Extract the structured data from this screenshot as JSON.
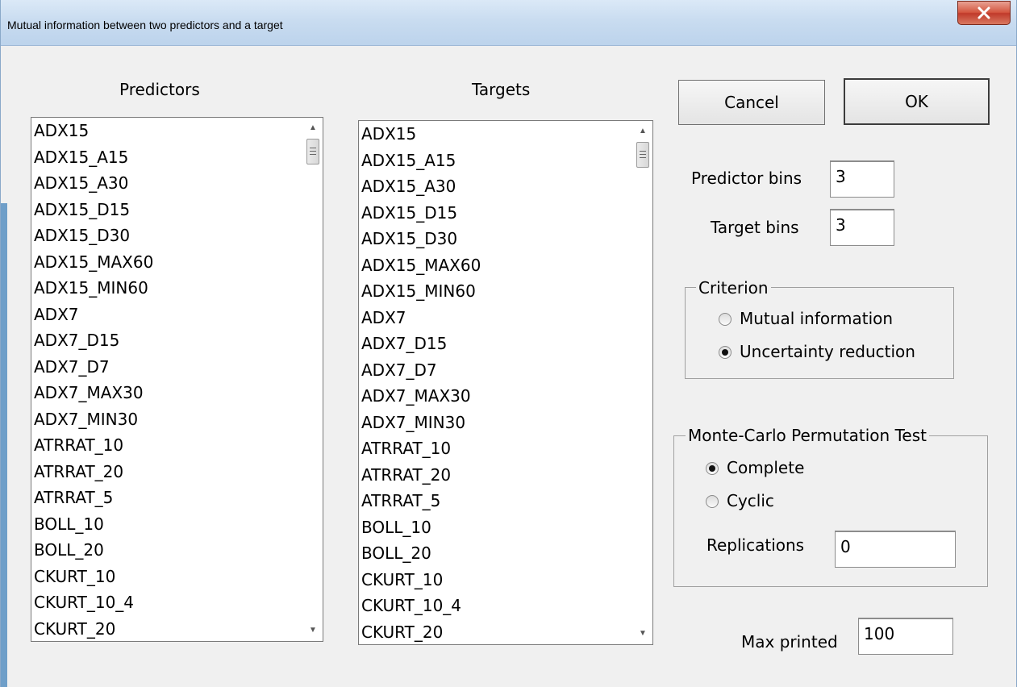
{
  "window": {
    "title": "Mutual information between two predictors and a target",
    "close_label": "X"
  },
  "predictors": {
    "label": "Predictors",
    "items": [
      "ADX15",
      "ADX15_A15",
      "ADX15_A30",
      "ADX15_D15",
      "ADX15_D30",
      "ADX15_MAX60",
      "ADX15_MIN60",
      "ADX7",
      "ADX7_D15",
      "ADX7_D7",
      "ADX7_MAX30",
      "ADX7_MIN30",
      "ATRRAT_10",
      "ATRRAT_20",
      "ATRRAT_5",
      "BOLL_10",
      "BOLL_20",
      "CKURT_10",
      "CKURT_10_4",
      "CKURT_20"
    ]
  },
  "targets": {
    "label": "Targets",
    "items": [
      "ADX15",
      "ADX15_A15",
      "ADX15_A30",
      "ADX15_D15",
      "ADX15_D30",
      "ADX15_MAX60",
      "ADX15_MIN60",
      "ADX7",
      "ADX7_D15",
      "ADX7_D7",
      "ADX7_MAX30",
      "ADX7_MIN30",
      "ATRRAT_10",
      "ATRRAT_20",
      "ATRRAT_5",
      "BOLL_10",
      "BOLL_20",
      "CKURT_10",
      "CKURT_10_4",
      "CKURT_20"
    ]
  },
  "buttons": {
    "cancel": "Cancel",
    "ok": "OK"
  },
  "bins": {
    "predictor_label": "Predictor bins",
    "predictor_value": "3",
    "target_label": "Target bins",
    "target_value": "3"
  },
  "criterion": {
    "legend": "Criterion",
    "options": [
      "Mutual information",
      "Uncertainty reduction"
    ],
    "selected": "Uncertainty reduction"
  },
  "monte_carlo": {
    "legend": "Monte-Carlo Permutation Test",
    "options": [
      "Complete",
      "Cyclic"
    ],
    "selected": "Complete",
    "replications_label": "Replications",
    "replications_value": "0"
  },
  "max_printed": {
    "label": "Max printed",
    "value": "100"
  },
  "icons": {
    "close": "close-icon",
    "scroll_up": "scroll-up-icon",
    "scroll_down": "scroll-down-icon"
  }
}
